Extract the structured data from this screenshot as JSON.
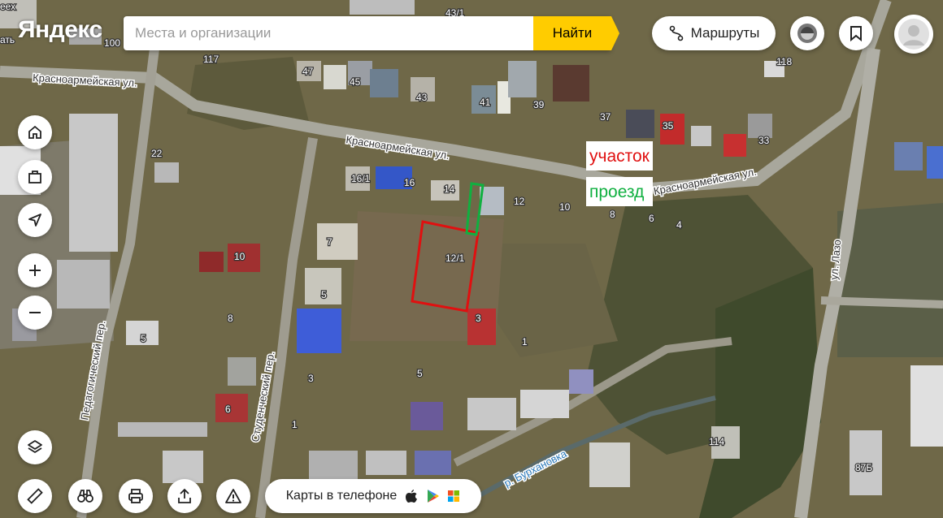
{
  "header": {
    "logo": "Яндекс",
    "search_placeholder": "Места и организации",
    "search_button": "Найти",
    "routes_button": "Маршруты"
  },
  "bottom": {
    "mobile_button": "Карты в телефоне"
  },
  "annotations": {
    "plot_label": "участок",
    "plot_color": "#e01010",
    "driveway_label": "проезд",
    "driveway_color": "#10b040"
  },
  "streets": {
    "krasnoarmeyskaya": "Красноармейская ул.",
    "pedagogichesky": "Педагогический пер.",
    "studenchesky": "Студенческий пер.",
    "lazo": "ул. Лазо",
    "river": "р. Бурхановка"
  },
  "house_numbers": [
    "100",
    "117",
    "47",
    "45",
    "43",
    "41",
    "39",
    "43/1",
    "118",
    "37",
    "35",
    "33",
    "22",
    "16/1",
    "16",
    "14",
    "12",
    "10",
    "8",
    "6",
    "4",
    "12/1",
    "7",
    "10",
    "5",
    "3",
    "8",
    "5",
    "1",
    "5",
    "3",
    "6",
    "1",
    "114",
    "87Б"
  ],
  "copyright_fragment": "ать",
  "top_left_fragment": "еех"
}
